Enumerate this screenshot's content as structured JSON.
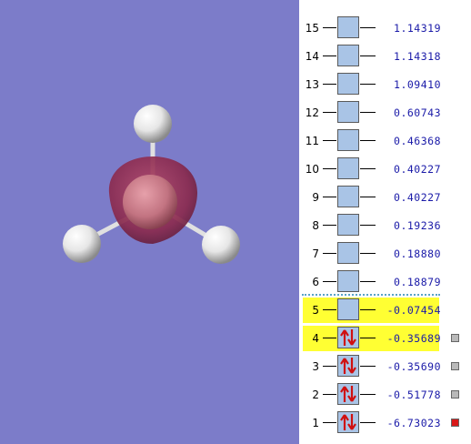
{
  "colors": {
    "background": "#7c7cc9",
    "orbital_box": "#a9c4e6",
    "energy_text": "#1a1aa8",
    "highlight": "#ffff33",
    "boron": "#c27381",
    "hydrogen": "#f2f2f2",
    "density": "#8a2a4e"
  },
  "molecule": {
    "atoms": [
      "boron",
      "hydrogen",
      "hydrogen",
      "hydrogen"
    ]
  },
  "orbitals": [
    {
      "index": "15",
      "energy": "1.14319",
      "occupied": false,
      "highlight": false,
      "marker": "none"
    },
    {
      "index": "14",
      "energy": "1.14318",
      "occupied": false,
      "highlight": false,
      "marker": "none"
    },
    {
      "index": "13",
      "energy": "1.09410",
      "occupied": false,
      "highlight": false,
      "marker": "none"
    },
    {
      "index": "12",
      "energy": "0.60743",
      "occupied": false,
      "highlight": false,
      "marker": "none"
    },
    {
      "index": "11",
      "energy": "0.46368",
      "occupied": false,
      "highlight": false,
      "marker": "none"
    },
    {
      "index": "10",
      "energy": "0.40227",
      "occupied": false,
      "highlight": false,
      "marker": "none"
    },
    {
      "index": "9",
      "energy": "0.40227",
      "occupied": false,
      "highlight": false,
      "marker": "none"
    },
    {
      "index": "8",
      "energy": "0.19236",
      "occupied": false,
      "highlight": false,
      "marker": "none"
    },
    {
      "index": "7",
      "energy": "0.18880",
      "occupied": false,
      "highlight": false,
      "marker": "none"
    },
    {
      "index": "6",
      "energy": "0.18879",
      "occupied": false,
      "highlight": false,
      "marker": "none"
    },
    {
      "index": "5",
      "energy": "-0.07454",
      "occupied": false,
      "highlight": true,
      "marker": "none"
    },
    {
      "index": "4",
      "energy": "-0.35689",
      "occupied": true,
      "highlight": true,
      "marker": "gray"
    },
    {
      "index": "3",
      "energy": "-0.35690",
      "occupied": true,
      "highlight": false,
      "marker": "gray"
    },
    {
      "index": "2",
      "energy": "-0.51778",
      "occupied": true,
      "highlight": false,
      "marker": "gray"
    },
    {
      "index": "1",
      "energy": "-6.73023",
      "occupied": true,
      "highlight": false,
      "marker": "red"
    }
  ]
}
